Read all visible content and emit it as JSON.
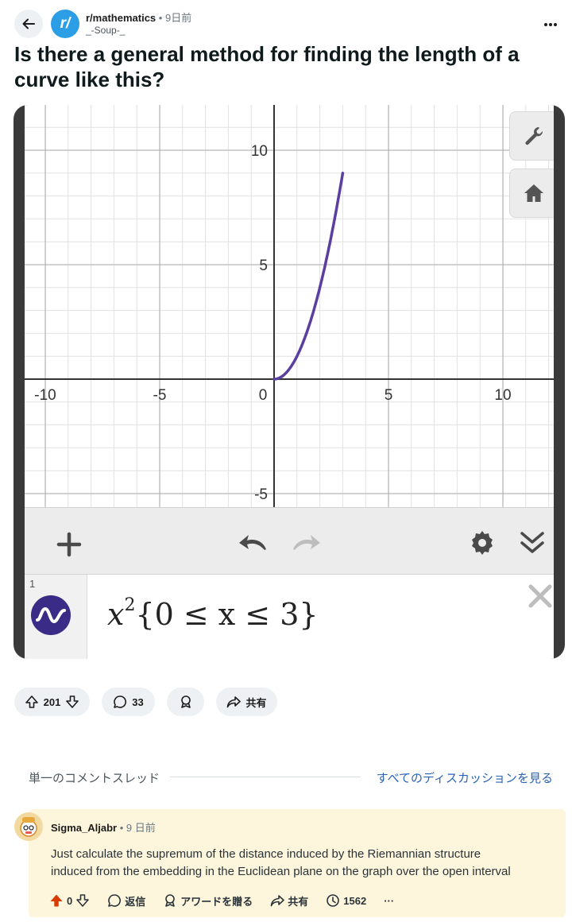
{
  "header": {
    "subreddit": "r/mathematics",
    "separator": "•",
    "time": "9日前",
    "author": "_-Soup-_",
    "avatar_text": "r/"
  },
  "post": {
    "title_line1": "Is there a general method for finding the length of a",
    "title_line2": "curve like this?"
  },
  "graph": {
    "x_ticks": [
      "-10",
      "-5",
      "0",
      "5",
      "10"
    ],
    "y_ticks": [
      "10",
      "5",
      "-5"
    ],
    "curve_color": "#5b3fa0",
    "expression_number": "1",
    "expression": {
      "base": "x",
      "exponent": "2",
      "open": "{",
      "condition": "0 ≤ x ≤ 3",
      "close": "}"
    }
  },
  "chart_data": {
    "type": "line",
    "title": "",
    "xlabel": "",
    "ylabel": "",
    "xlim": [
      -10.5,
      13
    ],
    "ylim": [
      -5.5,
      12
    ],
    "series": [
      {
        "x": [
          0,
          0.5,
          1,
          1.5,
          2,
          2.5,
          3
        ],
        "y": [
          0,
          0.25,
          1,
          2.25,
          4,
          6.25,
          9
        ]
      }
    ],
    "grid": true
  },
  "actions": {
    "votes": "201",
    "comments": "33",
    "share": "共有"
  },
  "thread": {
    "single_thread": "単一のコメントスレッド",
    "see_all": "すべてのディスカッションを見る"
  },
  "comment": {
    "user": "Sigma_Aljabr",
    "separator": "•",
    "time": "9 日前",
    "body_line1": "Just calculate the supremum of the distance induced by the Riemannian structure",
    "body_line2": "induced from the embedding in the Euclidean plane on the graph over the open interval",
    "votes": "0",
    "reply": "返信",
    "award": "アワードを贈る",
    "share": "共有",
    "views": "1562",
    "more": "···"
  },
  "colors": {
    "accent_blue": "#2b9ee6",
    "link_blue": "#2a62b5",
    "upvote_orange": "#d93a00",
    "comment_bg": "#fdf6dc"
  }
}
